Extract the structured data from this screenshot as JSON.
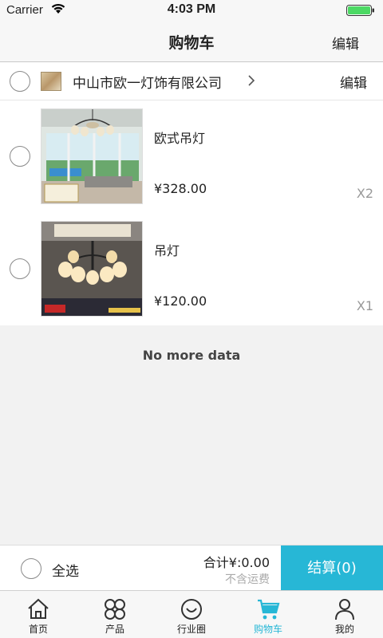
{
  "status": {
    "carrier": "Carrier",
    "time": "4:03 PM"
  },
  "nav": {
    "title": "购物车",
    "edit_label": "编辑"
  },
  "store": {
    "name": "中山市欧一灯饰有限公司",
    "edit_label": "编辑"
  },
  "items": [
    {
      "name": "欧式吊灯",
      "price": "¥328.00",
      "qty": "X2"
    },
    {
      "name": "吊灯",
      "price": "¥120.00",
      "qty": "X1"
    }
  ],
  "list_footer": "No more data",
  "checkout": {
    "select_all": "全选",
    "total": "合计¥:0.00",
    "shipping_note": "不含运费",
    "button": "结算(0)"
  },
  "tabs": [
    {
      "label": "首页",
      "icon": "home-icon"
    },
    {
      "label": "产品",
      "icon": "grid-icon"
    },
    {
      "label": "行业圈",
      "icon": "smile-icon"
    },
    {
      "label": "购物车",
      "icon": "cart-icon",
      "active": true
    },
    {
      "label": "我的",
      "icon": "user-icon"
    }
  ],
  "colors": {
    "accent": "#27b7d6",
    "background": "#f2f2f2"
  }
}
